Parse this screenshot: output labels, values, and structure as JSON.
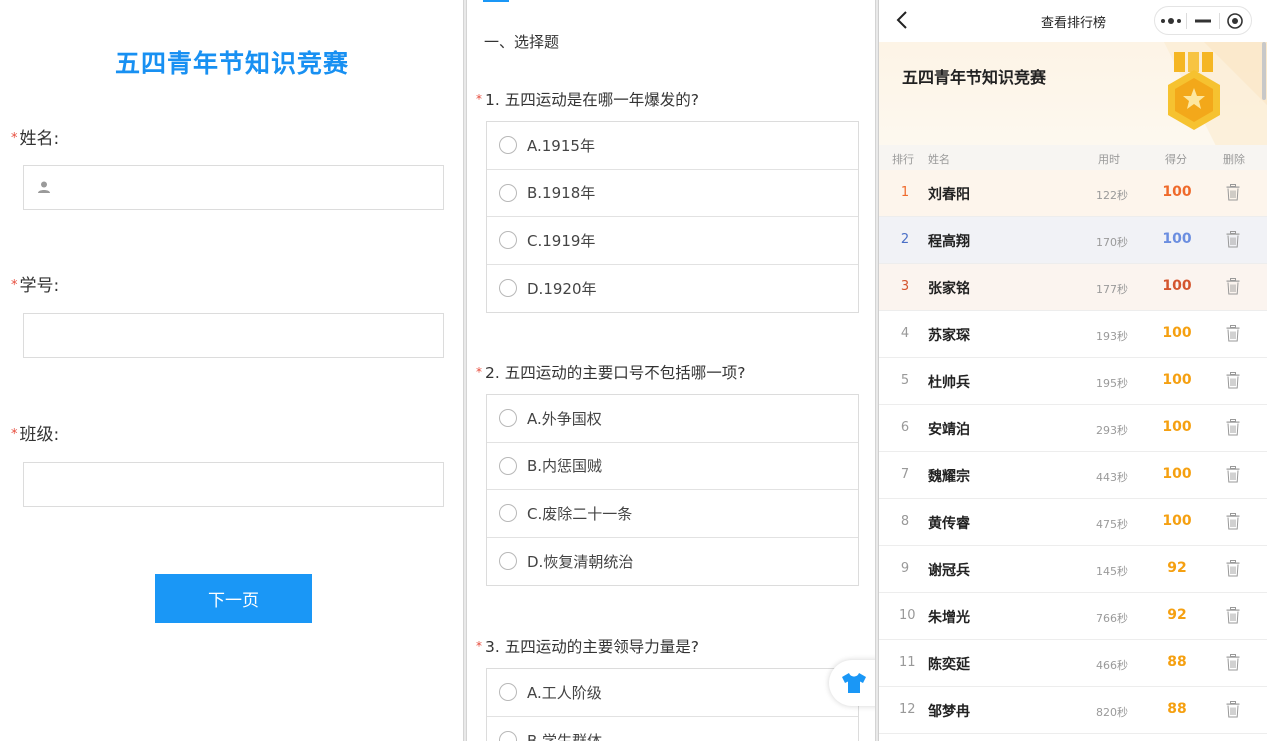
{
  "form": {
    "title": "五四青年节知识竞赛",
    "required_mark": "*",
    "name_label": "姓名:",
    "student_id_label": "学号:",
    "class_label": "班级:",
    "next_button": "下一页"
  },
  "quiz": {
    "section": "一、选择题",
    "required_mark": "*",
    "questions": [
      {
        "title": "1. 五四运动是在哪一年爆发的?",
        "options": [
          "A.1915年",
          "B.1918年",
          "C.1919年",
          "D.1920年"
        ]
      },
      {
        "title": "2. 五四运动的主要口号不包括哪一项?",
        "options": [
          "A.外争国权",
          "B.内惩国贼",
          "C.废除二十一条",
          "D.恢复清朝统治"
        ]
      },
      {
        "title": "3. 五四运动的主要领导力量是?",
        "options": [
          "A.工人阶级",
          "B.学生群体"
        ]
      }
    ],
    "float_icon": "shirt-icon"
  },
  "leaderboard": {
    "nav_title": "查看排行榜",
    "banner_title": "五四青年节知识竞赛",
    "headers": {
      "rank": "排行",
      "name": "姓名",
      "time": "用时",
      "score": "得分",
      "delete": "删除"
    },
    "rows": [
      {
        "rank": "1",
        "name": "刘春阳",
        "time": "122秒",
        "score": "100"
      },
      {
        "rank": "2",
        "name": "程高翔",
        "time": "170秒",
        "score": "100"
      },
      {
        "rank": "3",
        "name": "张家铭",
        "time": "177秒",
        "score": "100"
      },
      {
        "rank": "4",
        "name": "苏家琛",
        "time": "193秒",
        "score": "100"
      },
      {
        "rank": "5",
        "name": "杜帅兵",
        "time": "195秒",
        "score": "100"
      },
      {
        "rank": "6",
        "name": "安靖泊",
        "time": "293秒",
        "score": "100"
      },
      {
        "rank": "7",
        "name": "魏耀宗",
        "time": "443秒",
        "score": "100"
      },
      {
        "rank": "8",
        "name": "黄传睿",
        "time": "475秒",
        "score": "100"
      },
      {
        "rank": "9",
        "name": "谢冠兵",
        "time": "145秒",
        "score": "92"
      },
      {
        "rank": "10",
        "name": "朱增光",
        "time": "766秒",
        "score": "92"
      },
      {
        "rank": "11",
        "name": "陈奕延",
        "time": "466秒",
        "score": "88"
      },
      {
        "rank": "12",
        "name": "邹梦冉",
        "time": "820秒",
        "score": "88"
      }
    ]
  },
  "colors": {
    "brand_blue": "#1a97f6",
    "title_blue": "#1890f2",
    "required_red": "#e74c3c",
    "score_orange": "#f5a011",
    "rank1": "#ef6a2b",
    "rank2": "#4a6fc6",
    "rank3": "#d4552e"
  }
}
